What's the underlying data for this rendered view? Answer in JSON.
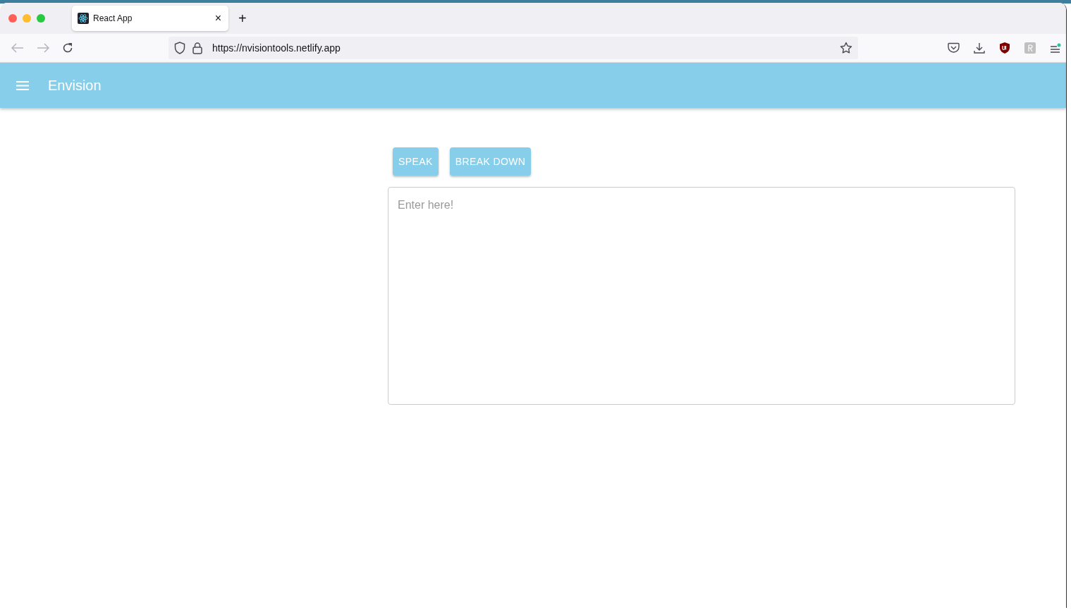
{
  "browser": {
    "tabs": [
      {
        "label": "React App",
        "selected": true
      }
    ],
    "close_tab_glyph": "×",
    "new_tab_glyph": "+",
    "url": "https://nvisiontools.netlify.app"
  },
  "app_bar": {
    "title": "Envision"
  },
  "buttons": [
    "SPEAK",
    "BREAK DOWN"
  ],
  "text_area": {
    "placeholder": "Enter here!"
  }
}
